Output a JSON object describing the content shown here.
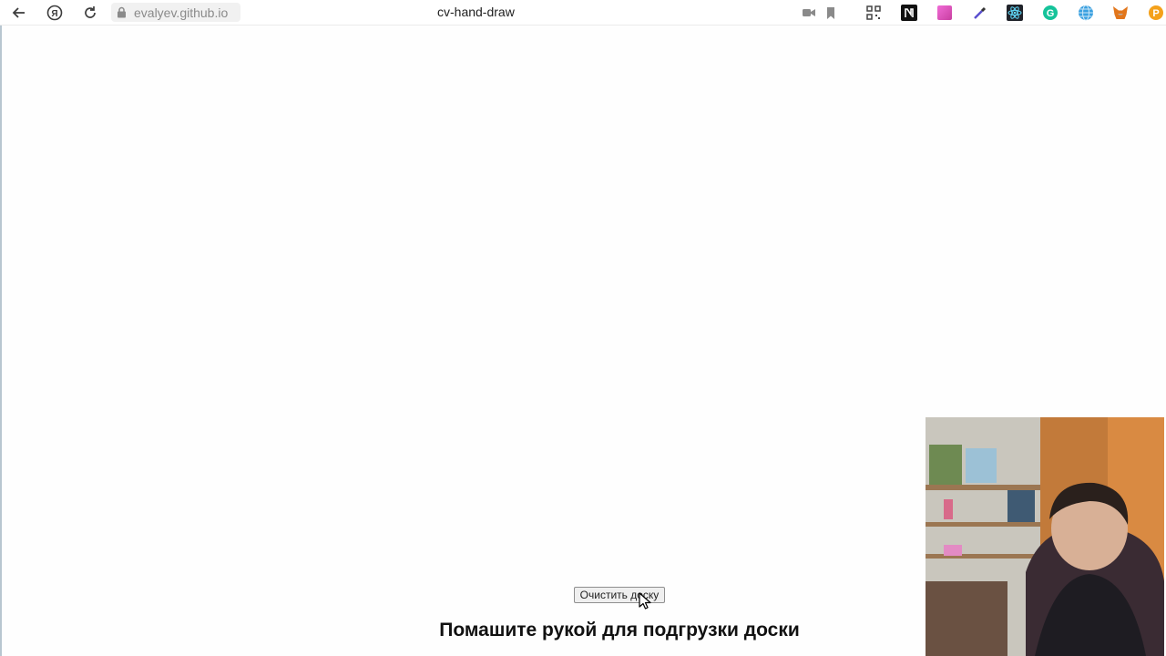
{
  "browser": {
    "address": "evalyev.github.io",
    "tab_title": "cv-hand-draw"
  },
  "page": {
    "clear_button_label": "Очистить доску",
    "hint_text": "Помашите рукой для подгрузки доски"
  },
  "colors": {
    "background": "#ffffff",
    "text": "#111111",
    "address_text": "#8a8a8a"
  },
  "icons": [
    "back-icon",
    "yandex-icon",
    "reload-icon",
    "lock-icon",
    "camera-icon",
    "bookmark-icon",
    "qr-icon",
    "notion-icon",
    "gradient-icon",
    "pipette-icon",
    "react-icon",
    "grammarly-icon",
    "globe-icon",
    "metamask-icon",
    "coin-icon",
    "mouse-cursor-icon"
  ]
}
